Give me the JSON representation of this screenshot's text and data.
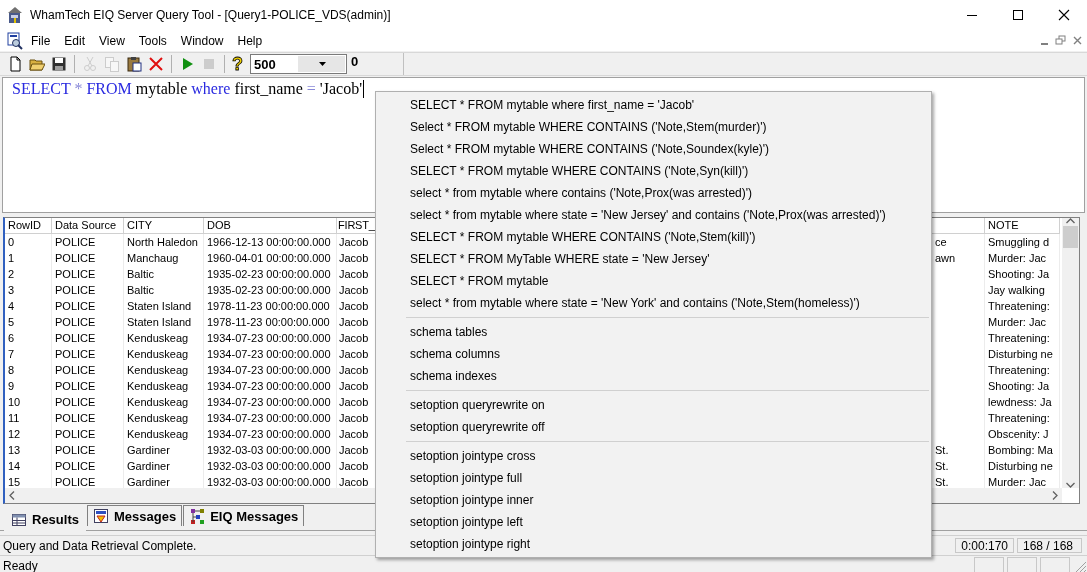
{
  "window": {
    "title": "WhamTech EIQ Server Query Tool - [Query1-POLICE_VDS(admin)]"
  },
  "menu_bar": [
    "File",
    "Edit",
    "View",
    "Tools",
    "Window",
    "Help"
  ],
  "toolbar": [
    {
      "kind": "new",
      "disabled": false
    },
    {
      "kind": "open",
      "disabled": false
    },
    {
      "kind": "save",
      "disabled": false
    },
    {
      "kind": "separator"
    },
    {
      "kind": "cut",
      "disabled": true
    },
    {
      "kind": "copy",
      "disabled": true
    },
    {
      "kind": "paste",
      "disabled": false
    },
    {
      "kind": "delete",
      "disabled": false
    },
    {
      "kind": "separator"
    },
    {
      "kind": "run",
      "disabled": false
    },
    {
      "kind": "stop",
      "disabled": true
    },
    {
      "kind": "separator"
    },
    {
      "kind": "help",
      "disabled": false,
      "glyph": "?"
    }
  ],
  "row_limit": {
    "value": "500"
  },
  "row_count": "0",
  "query": [
    {
      "text": "SELECT",
      "kind": "keyword"
    },
    {
      "text": "*",
      "kind": "operator"
    },
    {
      "text": "FROM",
      "kind": "keyword"
    },
    {
      "text": "mytable",
      "kind": "text"
    },
    {
      "text": "where",
      "kind": "keyword"
    },
    {
      "text": "first_name",
      "kind": "text"
    },
    {
      "text": "=",
      "kind": "operator"
    },
    {
      "text": "'Jacob'",
      "kind": "text"
    }
  ],
  "table": {
    "columns": [
      "RowID",
      "Data Source",
      "CITY",
      "DOB",
      "FIRST_",
      null,
      "NOTE"
    ],
    "rows": [
      [
        "0",
        "POLICE",
        "North Haledon",
        "1966-12-13 00:00:00.000",
        "Jacob",
        "ce",
        "Smuggling d"
      ],
      [
        "1",
        "POLICE",
        "Manchaug",
        "1960-04-01 00:00:00.000",
        "Jacob",
        "awn",
        "Murder: Jac"
      ],
      [
        "2",
        "POLICE",
        "Baltic",
        "1935-02-23 00:00:00.000",
        "Jacob",
        null,
        "Shooting: Ja"
      ],
      [
        "3",
        "POLICE",
        "Baltic",
        "1935-02-23 00:00:00.000",
        "Jacob",
        null,
        "Jay walking"
      ],
      [
        "4",
        "POLICE",
        "Staten Island",
        "1978-11-23 00:00:00.000",
        "Jacob",
        null,
        "Threatening:"
      ],
      [
        "5",
        "POLICE",
        "Staten Island",
        "1978-11-23 00:00:00.000",
        "Jacob",
        null,
        "Murder: Jac"
      ],
      [
        "6",
        "POLICE",
        "Kenduskeag",
        "1934-07-23 00:00:00.000",
        "Jacob",
        null,
        "Threatening:"
      ],
      [
        "7",
        "POLICE",
        "Kenduskeag",
        "1934-07-23 00:00:00.000",
        "Jacob",
        null,
        "Disturbing ne"
      ],
      [
        "8",
        "POLICE",
        "Kenduskeag",
        "1934-07-23 00:00:00.000",
        "Jacob",
        null,
        "Threatening:"
      ],
      [
        "9",
        "POLICE",
        "Kenduskeag",
        "1934-07-23 00:00:00.000",
        "Jacob",
        null,
        "Shooting: Ja"
      ],
      [
        "10",
        "POLICE",
        "Kenduskeag",
        "1934-07-23 00:00:00.000",
        "Jacob",
        null,
        "lewdness: Ja"
      ],
      [
        "11",
        "POLICE",
        "Kenduskeag",
        "1934-07-23 00:00:00.000",
        "Jacob",
        null,
        "Threatening:"
      ],
      [
        "12",
        "POLICE",
        "Kenduskeag",
        "1934-07-23 00:00:00.000",
        "Jacob",
        null,
        "Obscenity: J"
      ],
      [
        "13",
        "POLICE",
        "Gardiner",
        "1932-03-03 00:00:00.000",
        "Jacob",
        "St.",
        "Bombing: Ma"
      ],
      [
        "14",
        "POLICE",
        "Gardiner",
        "1932-03-03 00:00:00.000",
        "Jacob",
        "St.",
        "Disturbing ne"
      ],
      [
        "15",
        "POLICE",
        "Gardiner",
        "1932-03-03 00:00:00.000",
        "Jacob",
        "St.",
        "Murder: Jac"
      ]
    ]
  },
  "result_tabs": [
    {
      "label": "Results",
      "kind": "grid",
      "selected": true
    },
    {
      "label": "Messages",
      "kind": "messages",
      "selected": false
    },
    {
      "label": "EIQ Messages",
      "kind": "eiq",
      "selected": false
    }
  ],
  "status_bar": {
    "message": "Query and Data Retrieval Complete.",
    "panels": [
      "0:00:170",
      "168 / 168"
    ],
    "state": "Ready"
  },
  "context_menu": [
    {
      "kind": "item",
      "label": "SELECT * FROM mytable where first_name = 'Jacob'"
    },
    {
      "kind": "item",
      "label": "Select * FROM mytable WHERE CONTAINS ('Note,Stem(murder)')"
    },
    {
      "kind": "item",
      "label": "Select * FROM mytable WHERE CONTAINS ('Note,Soundex(kyle)')"
    },
    {
      "kind": "item",
      "label": "SELECT * FROM mytable WHERE CONTAINS ('Note,Syn(kill)')"
    },
    {
      "kind": "item",
      "label": "select * from mytable where contains ('Note,Prox(was arrested)')"
    },
    {
      "kind": "item",
      "label": "select * from mytable where state = 'New Jersey' and contains ('Note,Prox(was arrested)')"
    },
    {
      "kind": "item",
      "label": "SELECT * FROM mytable WHERE CONTAINS ('Note,Stem(kill)')"
    },
    {
      "kind": "item",
      "label": "SELECT * FROM MyTable WHERE state = 'New Jersey'"
    },
    {
      "kind": "item",
      "label": "SELECT * FROM mytable"
    },
    {
      "kind": "item",
      "label": "select * from mytable where state = 'New York' and contains ('Note,Stem(homeless)')"
    },
    {
      "kind": "separator"
    },
    {
      "kind": "item",
      "label": "schema tables"
    },
    {
      "kind": "item",
      "label": "schema columns"
    },
    {
      "kind": "item",
      "label": "schema indexes"
    },
    {
      "kind": "separator"
    },
    {
      "kind": "item",
      "label": "setoption queryrewrite on"
    },
    {
      "kind": "item",
      "label": "setoption queryrewrite off"
    },
    {
      "kind": "separator"
    },
    {
      "kind": "item",
      "label": "setoption jointype cross"
    },
    {
      "kind": "item",
      "label": "setoption jointype full"
    },
    {
      "kind": "item",
      "label": "setoption jointype inner"
    },
    {
      "kind": "item",
      "label": "setoption jointype left"
    },
    {
      "kind": "item",
      "label": "setoption jointype right"
    }
  ]
}
